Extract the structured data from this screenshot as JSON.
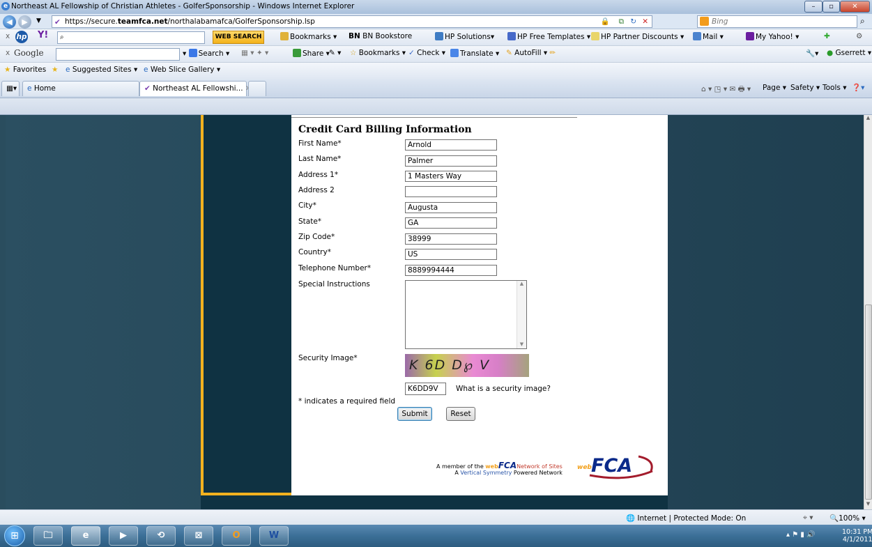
{
  "window": {
    "title": "Northeast AL Fellowship of Christian Athletes - GolferSponsorship - Windows Internet Explorer"
  },
  "address": {
    "prefix": "https://secure.",
    "host": "teamfca.net",
    "path": "/northalabamafca/GolferSponsorship.lsp",
    "search_placeholder": "Bing"
  },
  "toolbar1": {
    "web_search": "WEB SEARCH",
    "bookmarks": "Bookmarks",
    "bn": "BN Bookstore",
    "hp_solutions": "HP Solutions",
    "hp_templates": "HP Free Templates",
    "hp_partner": "HP Partner Discounts",
    "mail": "Mail",
    "my_yahoo": "My Yahoo!"
  },
  "toolbar2": {
    "google": "Google",
    "search": "Search",
    "share": "Share",
    "bookmarks": "Bookmarks",
    "check": "Check",
    "translate": "Translate",
    "autofill": "AutoFill",
    "user": "Gserrett"
  },
  "favbar": {
    "favorites": "Favorites",
    "suggested": "Suggested Sites",
    "slice": "Web Slice Gallery"
  },
  "tabs": {
    "home": "Home",
    "active": "Northeast AL Fellowshi...",
    "page": "Page",
    "safety": "Safety",
    "tools": "Tools"
  },
  "form": {
    "heading": "Credit Card Billing Information",
    "fields": [
      {
        "label": "First Name*",
        "value": "Arnold"
      },
      {
        "label": "Last Name*",
        "value": "Palmer"
      },
      {
        "label": "Address 1*",
        "value": "1 Masters Way"
      },
      {
        "label": "Address 2",
        "value": ""
      },
      {
        "label": "City*",
        "value": "Augusta"
      },
      {
        "label": "State*",
        "value": "GA"
      },
      {
        "label": "Zip Code*",
        "value": "38999"
      },
      {
        "label": "Country*",
        "value": "US"
      },
      {
        "label": "Telephone Number*",
        "value": "8889994444"
      }
    ],
    "special_label": "Special Instructions",
    "security_label": "Security Image*",
    "captcha_text": "K 6D D℘ V",
    "captcha_value": "K6DD9V",
    "security_link": "What is a security image?",
    "required_note": "* indicates a required field",
    "submit": "Submit",
    "reset": "Reset"
  },
  "footer": {
    "line1_a": "A member of the ",
    "web": "web",
    "fca": "FCA",
    "line1_b": "Network of Sites",
    "line2_a": "A ",
    "vs": "Vertical Symmetry",
    "line2_b": " Powered Network",
    "logo_web": "web",
    "logo_fca": "FCA"
  },
  "status": {
    "zone": "Internet | Protected Mode: On",
    "zoom": "100%"
  },
  "clock": {
    "time": "10:31 PM",
    "date": "4/1/2011"
  },
  "colors": {
    "frame_border": "#f2b21f",
    "page_bg": "#2a4d5e",
    "panel": "#0f3242"
  }
}
